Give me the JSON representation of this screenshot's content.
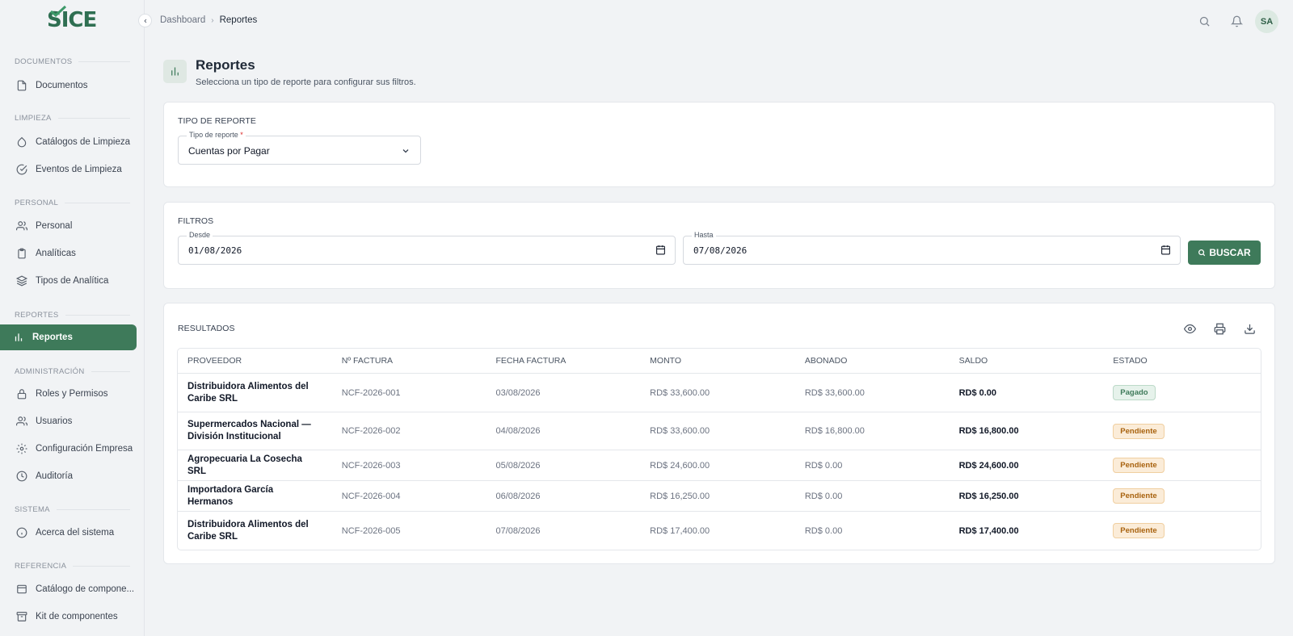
{
  "app": {
    "logo_text": "ICE",
    "logo_first": "S"
  },
  "sidebar": {
    "sections": [
      {
        "label": "Documentos",
        "items": [
          {
            "label": "Documentos",
            "icon": "file-icon"
          }
        ]
      },
      {
        "label": "Limpieza",
        "items": [
          {
            "label": "Catálogos de Limpieza",
            "icon": "droplet-icon"
          },
          {
            "label": "Eventos de Limpieza",
            "icon": "check-circle-icon"
          }
        ]
      },
      {
        "label": "Personal",
        "items": [
          {
            "label": "Personal",
            "icon": "users-icon"
          },
          {
            "label": "Analíticas",
            "icon": "clipboard-icon"
          },
          {
            "label": "Tipos de Analítica",
            "icon": "layers-icon"
          }
        ]
      },
      {
        "label": "Reportes",
        "items": [
          {
            "label": "Reportes",
            "icon": "bar-chart-icon",
            "active": true
          }
        ]
      },
      {
        "label": "Administración",
        "items": [
          {
            "label": "Roles y Permisos",
            "icon": "lock-icon"
          },
          {
            "label": "Usuarios",
            "icon": "users-icon"
          },
          {
            "label": "Configuración Empresa",
            "icon": "gear-icon"
          },
          {
            "label": "Auditoría",
            "icon": "clock-icon"
          }
        ]
      },
      {
        "label": "Sistema",
        "items": [
          {
            "label": "Acerca del sistema",
            "icon": "info-icon"
          }
        ]
      },
      {
        "label": "Referencia",
        "items": [
          {
            "label": "Catálogo de compone...",
            "icon": "window-icon"
          },
          {
            "label": "Kit de componentes",
            "icon": "archive-icon"
          }
        ]
      }
    ]
  },
  "header": {
    "breadcrumb": [
      "Dashboard",
      "Reportes"
    ],
    "avatar": "SA"
  },
  "page": {
    "title": "Reportes",
    "subtitle": "Selecciona un tipo de reporte para configurar sus filtros."
  },
  "tipo_reporte": {
    "section_label": "Tipo de reporte",
    "field_label": "Tipo de reporte",
    "required_mark": "*",
    "value": "Cuentas por Pagar"
  },
  "filtros": {
    "section_label": "Filtros",
    "desde_label": "Desde",
    "desde_value": "01/08/2026",
    "hasta_label": "Hasta",
    "hasta_value": "07/08/2026",
    "buscar_label": "BUSCAR"
  },
  "resultados": {
    "section_label": "Resultados",
    "columns": [
      "Proveedor",
      "Nº Factura",
      "Fecha Factura",
      "Monto",
      "Abonado",
      "Saldo",
      "Estado"
    ],
    "rows": [
      {
        "proveedor": "Distribuidora Alimentos del Caribe SRL",
        "factura": "NCF-2026-001",
        "fecha": "03/08/2026",
        "monto": "RD$ 33,600.00",
        "abonado": "RD$ 33,600.00",
        "saldo": "RD$ 0.00",
        "estado": "Pagado"
      },
      {
        "proveedor": "Supermercados Nacional — División Institucional",
        "factura": "NCF-2026-002",
        "fecha": "04/08/2026",
        "monto": "RD$ 33,600.00",
        "abonado": "RD$ 16,800.00",
        "saldo": "RD$ 16,800.00",
        "estado": "Pendiente"
      },
      {
        "proveedor": "Agropecuaria La Cosecha SRL",
        "factura": "NCF-2026-003",
        "fecha": "05/08/2026",
        "monto": "RD$ 24,600.00",
        "abonado": "RD$ 0.00",
        "saldo": "RD$ 24,600.00",
        "estado": "Pendiente"
      },
      {
        "proveedor": "Importadora García Hermanos",
        "factura": "NCF-2026-004",
        "fecha": "06/08/2026",
        "monto": "RD$ 16,250.00",
        "abonado": "RD$ 0.00",
        "saldo": "RD$ 16,250.00",
        "estado": "Pendiente"
      },
      {
        "proveedor": "Distribuidora Alimentos del Caribe SRL",
        "factura": "NCF-2026-005",
        "fecha": "07/08/2026",
        "monto": "RD$ 17,400.00",
        "abonado": "RD$ 0.00",
        "saldo": "RD$ 17,400.00",
        "estado": "Pendiente"
      }
    ]
  },
  "colors": {
    "accent": "#3e7a5a",
    "pending_bg": "#fbecd8",
    "pending_text": "#a8620e",
    "paid_bg": "#e6f2eb"
  }
}
